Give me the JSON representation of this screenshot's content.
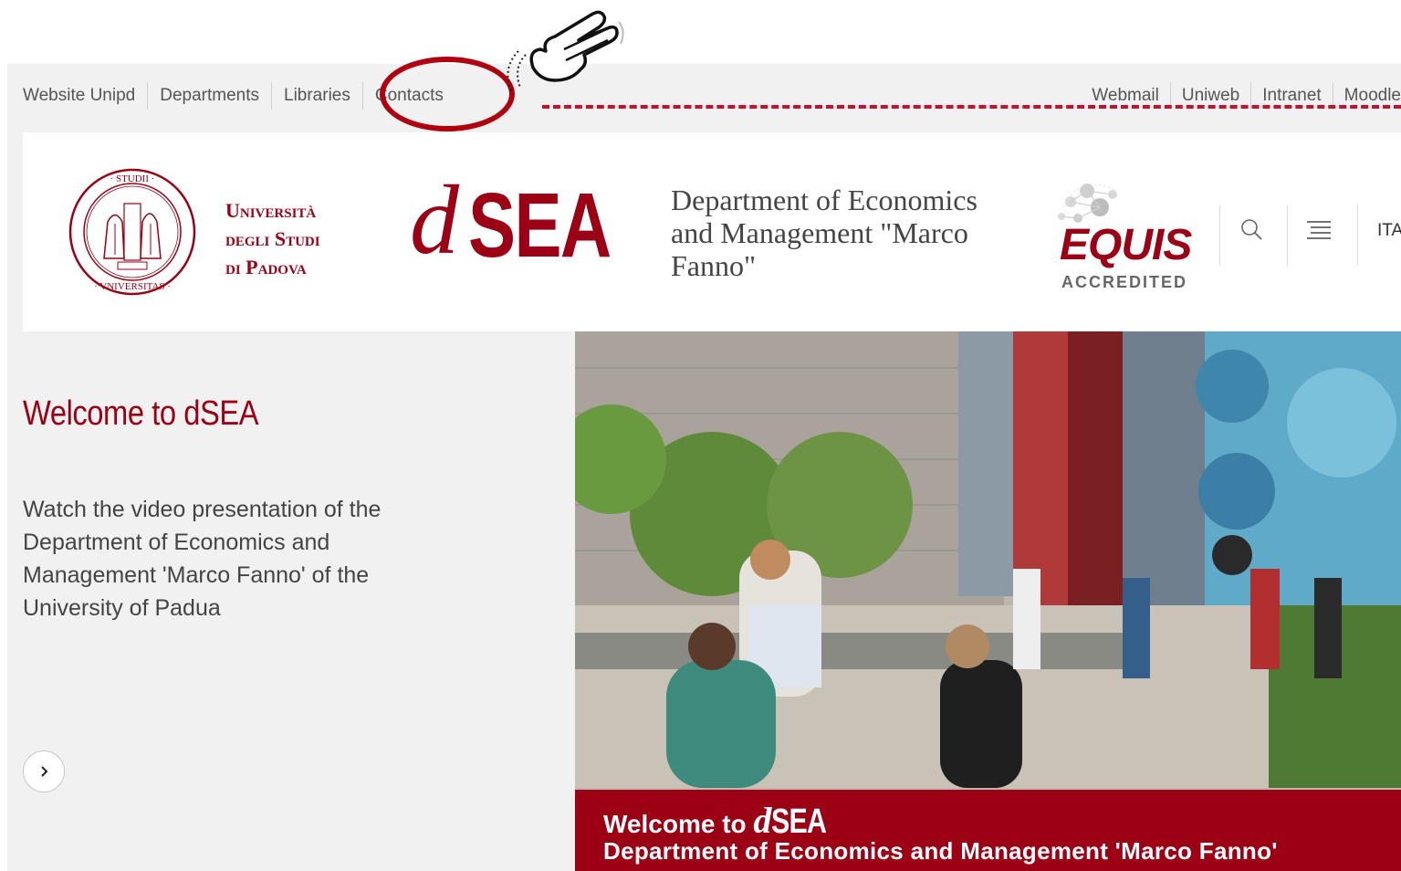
{
  "topbar": {
    "left_links": [
      "Website Unipd",
      "Departments",
      "Libraries",
      "Contacts"
    ],
    "right_links": [
      "Webmail",
      "Uniweb",
      "Intranet",
      "Moodle"
    ]
  },
  "header": {
    "university": {
      "line1": "Università",
      "line2": "degli Studi",
      "line3": "di Padova"
    },
    "logo_text": "SEA",
    "logo_d": "d",
    "department": "Department of Economics and Management \"Marco Fanno\"",
    "accreditation": {
      "name": "EQUIS",
      "label": "ACCREDITED"
    },
    "language": "ITA"
  },
  "welcome": {
    "title": "Welcome to dSEA",
    "text": "Watch the video presentation of the Department of Economics and Management 'Marco Fanno' of the University of Padua"
  },
  "hero": {
    "caption_prefix": "Welcome to",
    "caption_d": "d",
    "caption_sea": "SEA",
    "caption_line2": "Department of Economics and Management 'Marco Fanno'"
  },
  "colors": {
    "brand": "#9b0014",
    "annotation": "#b00010",
    "background": "#f1f1f1"
  },
  "icons": [
    "university-seal-icon",
    "equis-logo-icon",
    "search-icon",
    "menu-icon",
    "chevron-right-icon",
    "pointing-hand-icon"
  ]
}
